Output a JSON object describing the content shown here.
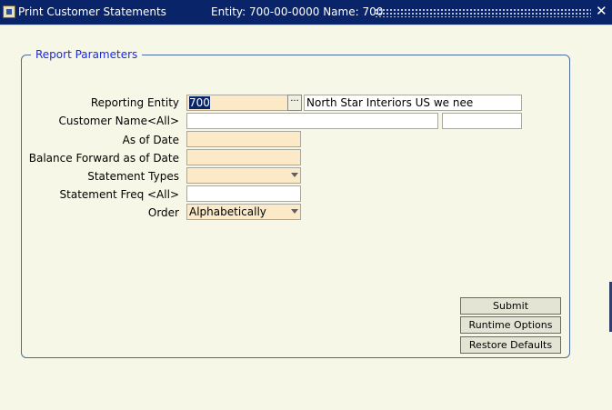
{
  "window": {
    "title": "Print Customer Statements",
    "entity_info": "Entity: 700-00-0000  Name: 700",
    "close_glyph": "✕",
    "icon": "app-icon"
  },
  "group": {
    "title": "Report Parameters"
  },
  "fields": {
    "reporting_entity": {
      "label": "Reporting Entity",
      "value": "700",
      "lov_glyph": "···",
      "description": "North Star Interiors US we nee"
    },
    "customer_name": {
      "label": "Customer Name<All>",
      "value": "",
      "extra_value": ""
    },
    "as_of_date": {
      "label": "As of Date",
      "value": ""
    },
    "balance_forward": {
      "label": "Balance Forward as of Date",
      "value": ""
    },
    "statement_types": {
      "label": "Statement Types",
      "value": ""
    },
    "statement_freq": {
      "label": "Statement Freq <All>",
      "value": ""
    },
    "order": {
      "label": "Order",
      "value": "Alphabetically"
    }
  },
  "buttons": {
    "submit": "Submit",
    "runtime_options": "Runtime Options",
    "restore_defaults": "Restore Defaults"
  },
  "colors": {
    "title_bar": "#0a246a",
    "required_field": "#fbe9c8",
    "group_title": "#1a2ad8",
    "background": "#f7f7e7"
  }
}
